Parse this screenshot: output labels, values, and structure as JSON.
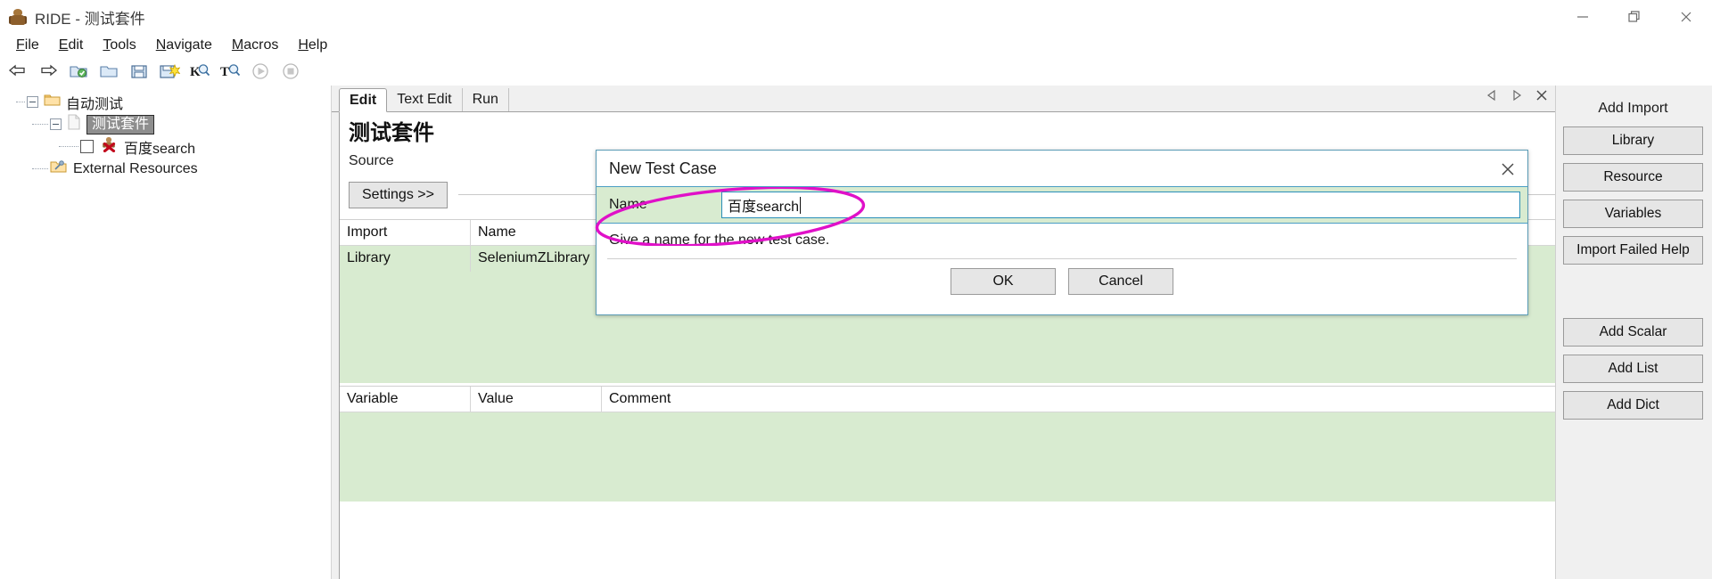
{
  "window": {
    "title": "RIDE - 测试套件",
    "app_icon": "robot-icon",
    "controls": [
      {
        "name": "minimize-button",
        "glyph": "minimize-icon"
      },
      {
        "name": "restore-button",
        "glyph": "restore-icon"
      },
      {
        "name": "close-button",
        "glyph": "close-icon"
      }
    ]
  },
  "menubar": {
    "items": [
      {
        "label": "File",
        "accel": "F"
      },
      {
        "label": "Edit",
        "accel": "E"
      },
      {
        "label": "Tools",
        "accel": "T"
      },
      {
        "label": "Navigate",
        "accel": "N"
      },
      {
        "label": "Macros",
        "accel": "M"
      },
      {
        "label": "Help",
        "accel": "H"
      }
    ]
  },
  "toolbar": {
    "buttons": [
      {
        "name": "back-arrow-icon",
        "title": "Back"
      },
      {
        "name": "forward-arrow-icon",
        "title": "Forward"
      },
      {
        "name": "open-directory-icon",
        "title": "Open Directory"
      },
      {
        "name": "open-folder-icon",
        "title": "Open"
      },
      {
        "name": "save-icon",
        "title": "Save"
      },
      {
        "name": "save-all-icon",
        "title": "Save All"
      },
      {
        "name": "search-keyword-icon",
        "title": "Search Keywords"
      },
      {
        "name": "search-text-icon",
        "title": "Search Tests"
      },
      {
        "name": "run-icon",
        "title": "Run"
      },
      {
        "name": "stop-icon",
        "title": "Stop"
      }
    ]
  },
  "tree": {
    "nodes": [
      {
        "label": "自动测试",
        "icon": "folder-icon",
        "level": 0,
        "expanded": true,
        "selected": false,
        "checkbox": false
      },
      {
        "label": "测试套件",
        "icon": "file-icon",
        "level": 1,
        "expanded": true,
        "selected": true,
        "checkbox": false
      },
      {
        "label": "百度search",
        "icon": "testcase-icon",
        "level": 2,
        "expanded": false,
        "selected": false,
        "checkbox": true
      },
      {
        "label": "External Resources",
        "icon": "resources-icon",
        "level": 1,
        "expanded": false,
        "selected": false,
        "checkbox": false
      }
    ]
  },
  "editor": {
    "tabs": [
      {
        "label": "Edit",
        "active": true
      },
      {
        "label": "Text Edit",
        "active": false
      },
      {
        "label": "Run",
        "active": false
      }
    ],
    "tab_nav": [
      {
        "name": "tab-scroll-left-icon",
        "glyph": "◁"
      },
      {
        "name": "tab-scroll-right-icon",
        "glyph": "▷"
      },
      {
        "name": "tab-close-icon",
        "glyph": "✕"
      }
    ],
    "doc_title": "测试套件",
    "source_label": "Source",
    "settings_button": "Settings >>",
    "import_table": {
      "headers": [
        "Import",
        "Name",
        ""
      ],
      "rows": [
        [
          "Library",
          "SeleniumZLibrary",
          ""
        ]
      ]
    },
    "variable_table": {
      "headers": [
        "Variable",
        "Value",
        "Comment"
      ],
      "rows": []
    }
  },
  "right_panel": {
    "import_title": "Add Import",
    "import_buttons": [
      "Library",
      "Resource",
      "Variables",
      "Import Failed Help"
    ],
    "variable_buttons": [
      "Add Scalar",
      "Add List",
      "Add Dict"
    ]
  },
  "dialog": {
    "title": "New Test Case",
    "close_icon": "close-icon",
    "field_label": "Name",
    "field_value": "百度search",
    "field_placeholder": "",
    "hint": "Give a name for the new test case.",
    "ok_label": "OK",
    "cancel_label": "Cancel"
  },
  "annotation": {
    "shape": "ellipse",
    "color": "#e010c8"
  },
  "colors": {
    "grid_green": "#d8ebd0",
    "dialog_border": "#4a9ec4",
    "selection_gray": "#8e8e8e",
    "annotation_pink": "#e010c8"
  }
}
